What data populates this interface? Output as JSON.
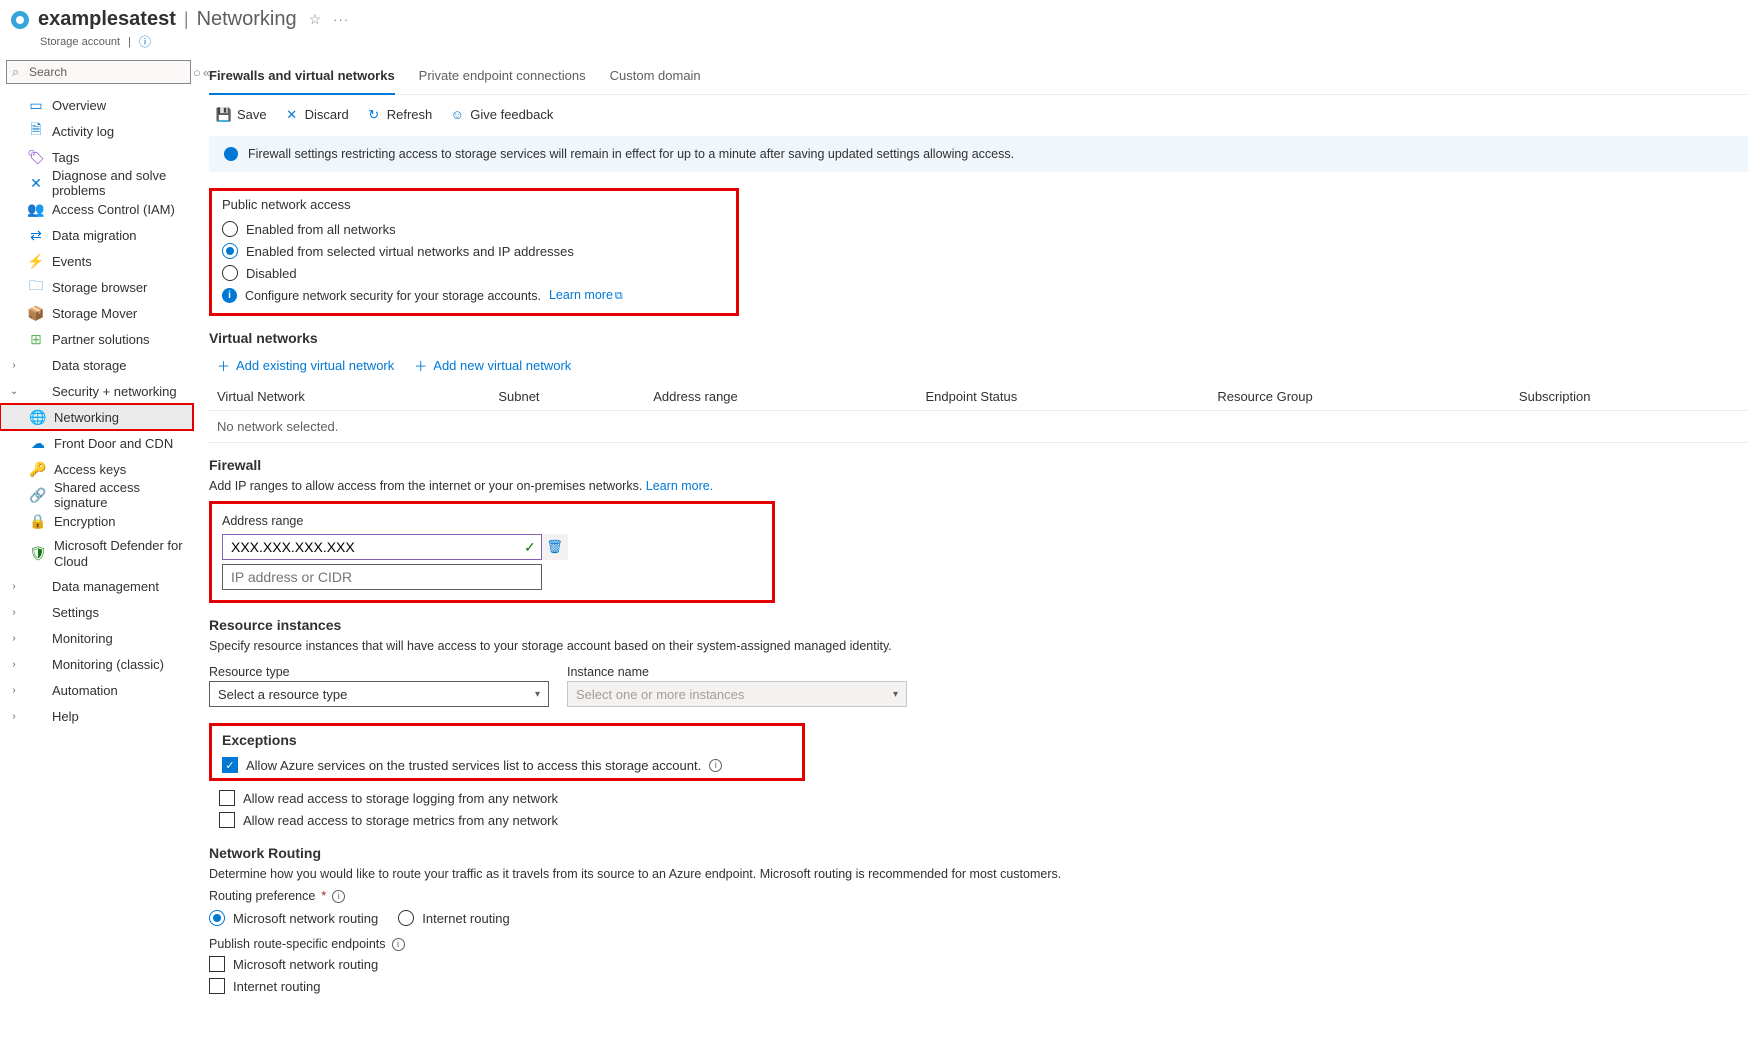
{
  "header": {
    "title": "examplesatest",
    "page": "Networking",
    "subtitle": "Storage account"
  },
  "sidebar": {
    "search_ph": "Search",
    "items": [
      {
        "icon": "overview",
        "label": "Overview",
        "color": "#0078d4"
      },
      {
        "icon": "activity",
        "label": "Activity log",
        "color": "#0078d4"
      },
      {
        "icon": "tags",
        "label": "Tags",
        "color": "#7b2fbf"
      },
      {
        "icon": "diagnose",
        "label": "Diagnose and solve problems",
        "color": "#0078d4"
      },
      {
        "icon": "iam",
        "label": "Access Control (IAM)",
        "color": "#d65b00"
      },
      {
        "icon": "datamig",
        "label": "Data migration",
        "color": "#0078d4"
      },
      {
        "icon": "events",
        "label": "Events",
        "color": "#f2c811"
      },
      {
        "icon": "browser",
        "label": "Storage browser",
        "color": "#0078d4"
      },
      {
        "icon": "mover",
        "label": "Storage Mover",
        "color": "#6b2e00"
      },
      {
        "icon": "partner",
        "label": "Partner solutions",
        "color": "#5fb85f"
      }
    ],
    "groups": {
      "data_storage": "Data storage",
      "sec_net": "Security + networking",
      "data_mgmt": "Data management",
      "settings": "Settings",
      "monitoring": "Monitoring",
      "monitoring_classic": "Monitoring (classic)",
      "automation": "Automation",
      "help": "Help"
    },
    "secnet": [
      {
        "icon": "net",
        "label": "Networking",
        "color": "#0078d4",
        "selected": true
      },
      {
        "icon": "fd",
        "label": "Front Door and CDN",
        "color": "#0078d4"
      },
      {
        "icon": "keys",
        "label": "Access keys",
        "color": "#f2c811"
      },
      {
        "icon": "sas",
        "label": "Shared access signature",
        "color": "#0078d4"
      },
      {
        "icon": "enc",
        "label": "Encryption",
        "color": "#0078d4"
      },
      {
        "icon": "def",
        "label": "Microsoft Defender for Cloud",
        "color": "#107c10"
      }
    ]
  },
  "tabs": [
    {
      "label": "Firewalls and virtual networks",
      "active": true
    },
    {
      "label": "Private endpoint connections"
    },
    {
      "label": "Custom domain"
    }
  ],
  "toolbar": {
    "save": "Save",
    "discard": "Discard",
    "refresh": "Refresh",
    "feedback": "Give feedback"
  },
  "banner": "Firewall settings restricting access to storage services will remain in effect for up to a minute after saving updated settings allowing access.",
  "pna": {
    "title": "Public network access",
    "opts": [
      "Enabled from all networks",
      "Enabled from selected virtual networks and IP addresses",
      "Disabled"
    ],
    "selected": 1,
    "config_text": "Configure network security for your storage accounts.",
    "learn": "Learn more"
  },
  "vnet": {
    "title": "Virtual networks",
    "add_existing": "Add existing virtual network",
    "add_new": "Add new virtual network",
    "cols": [
      "Virtual Network",
      "Subnet",
      "Address range",
      "Endpoint Status",
      "Resource Group",
      "Subscription"
    ],
    "empty": "No network selected."
  },
  "firewall": {
    "title": "Firewall",
    "desc": "Add IP ranges to allow access from the internet or your on-premises networks.",
    "learn": "Learn more.",
    "col": "Address range",
    "val": "XXX.XXX.XXX.XXX",
    "ph": "IP address or CIDR"
  },
  "resinst": {
    "title": "Resource instances",
    "desc": "Specify resource instances that will have access to your storage account based on their system-assigned managed identity.",
    "col1": "Resource type",
    "col2": "Instance name",
    "ph1": "Select a resource type",
    "ph2": "Select one or more instances"
  },
  "exceptions": {
    "title": "Exceptions",
    "opts": [
      {
        "label": "Allow Azure services on the trusted services list to access this storage account.",
        "checked": true,
        "info": true
      },
      {
        "label": "Allow read access to storage logging from any network",
        "checked": false
      },
      {
        "label": "Allow read access to storage metrics from any network",
        "checked": false
      }
    ]
  },
  "routing": {
    "title": "Network Routing",
    "desc": "Determine how you would like to route your traffic as it travels from its source to an Azure endpoint. Microsoft routing is recommended for most customers.",
    "pref_label": "Routing preference",
    "opts": [
      "Microsoft network routing",
      "Internet routing"
    ],
    "selected": 0,
    "pub_label": "Publish route-specific endpoints",
    "pub_opts": [
      {
        "label": "Microsoft network routing",
        "checked": false
      },
      {
        "label": "Internet routing",
        "checked": false
      }
    ]
  }
}
